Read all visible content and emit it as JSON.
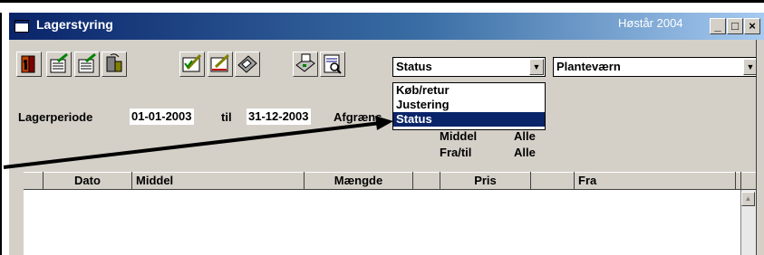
{
  "window": {
    "title": "Lagerstyring",
    "year_label": "Høstår 2004"
  },
  "title_buttons": {
    "minimize": "_",
    "maximize": "□",
    "close": "×"
  },
  "toolbar": {
    "icons": [
      "door-exit-icon",
      "edit-list-icon",
      "edit-list-2-icon",
      "transfer-icon",
      "pencil-check-icon",
      "pencil-arrows-icon",
      "calculator-icon",
      "printer-icon",
      "print-preview-icon"
    ]
  },
  "type_combo": {
    "selected": "Status",
    "options": [
      "Køb/retur",
      "Justering",
      "Status"
    ]
  },
  "category_combo": {
    "selected": "Planteværn"
  },
  "filter": {
    "period_label": "Lagerperiode",
    "from_date": "01-01-2003",
    "to_label": "til",
    "to_date": "31-12-2003",
    "limit_label": "Afgræns",
    "middel_label": "Middel",
    "middel_value": "Alle",
    "fratil_label": "Fra/til",
    "fratil_value": "Alle"
  },
  "grid": {
    "columns": [
      "Dato",
      "Middel",
      "Mængde",
      "",
      "Pris",
      "",
      "Fra"
    ],
    "rows": []
  },
  "scrollbar": {
    "up_glyph": "▲"
  },
  "colors": {
    "title_start": "#0a246a",
    "title_end": "#a6caf0",
    "face": "#d4d0c8",
    "highlight": "#0a246a"
  }
}
